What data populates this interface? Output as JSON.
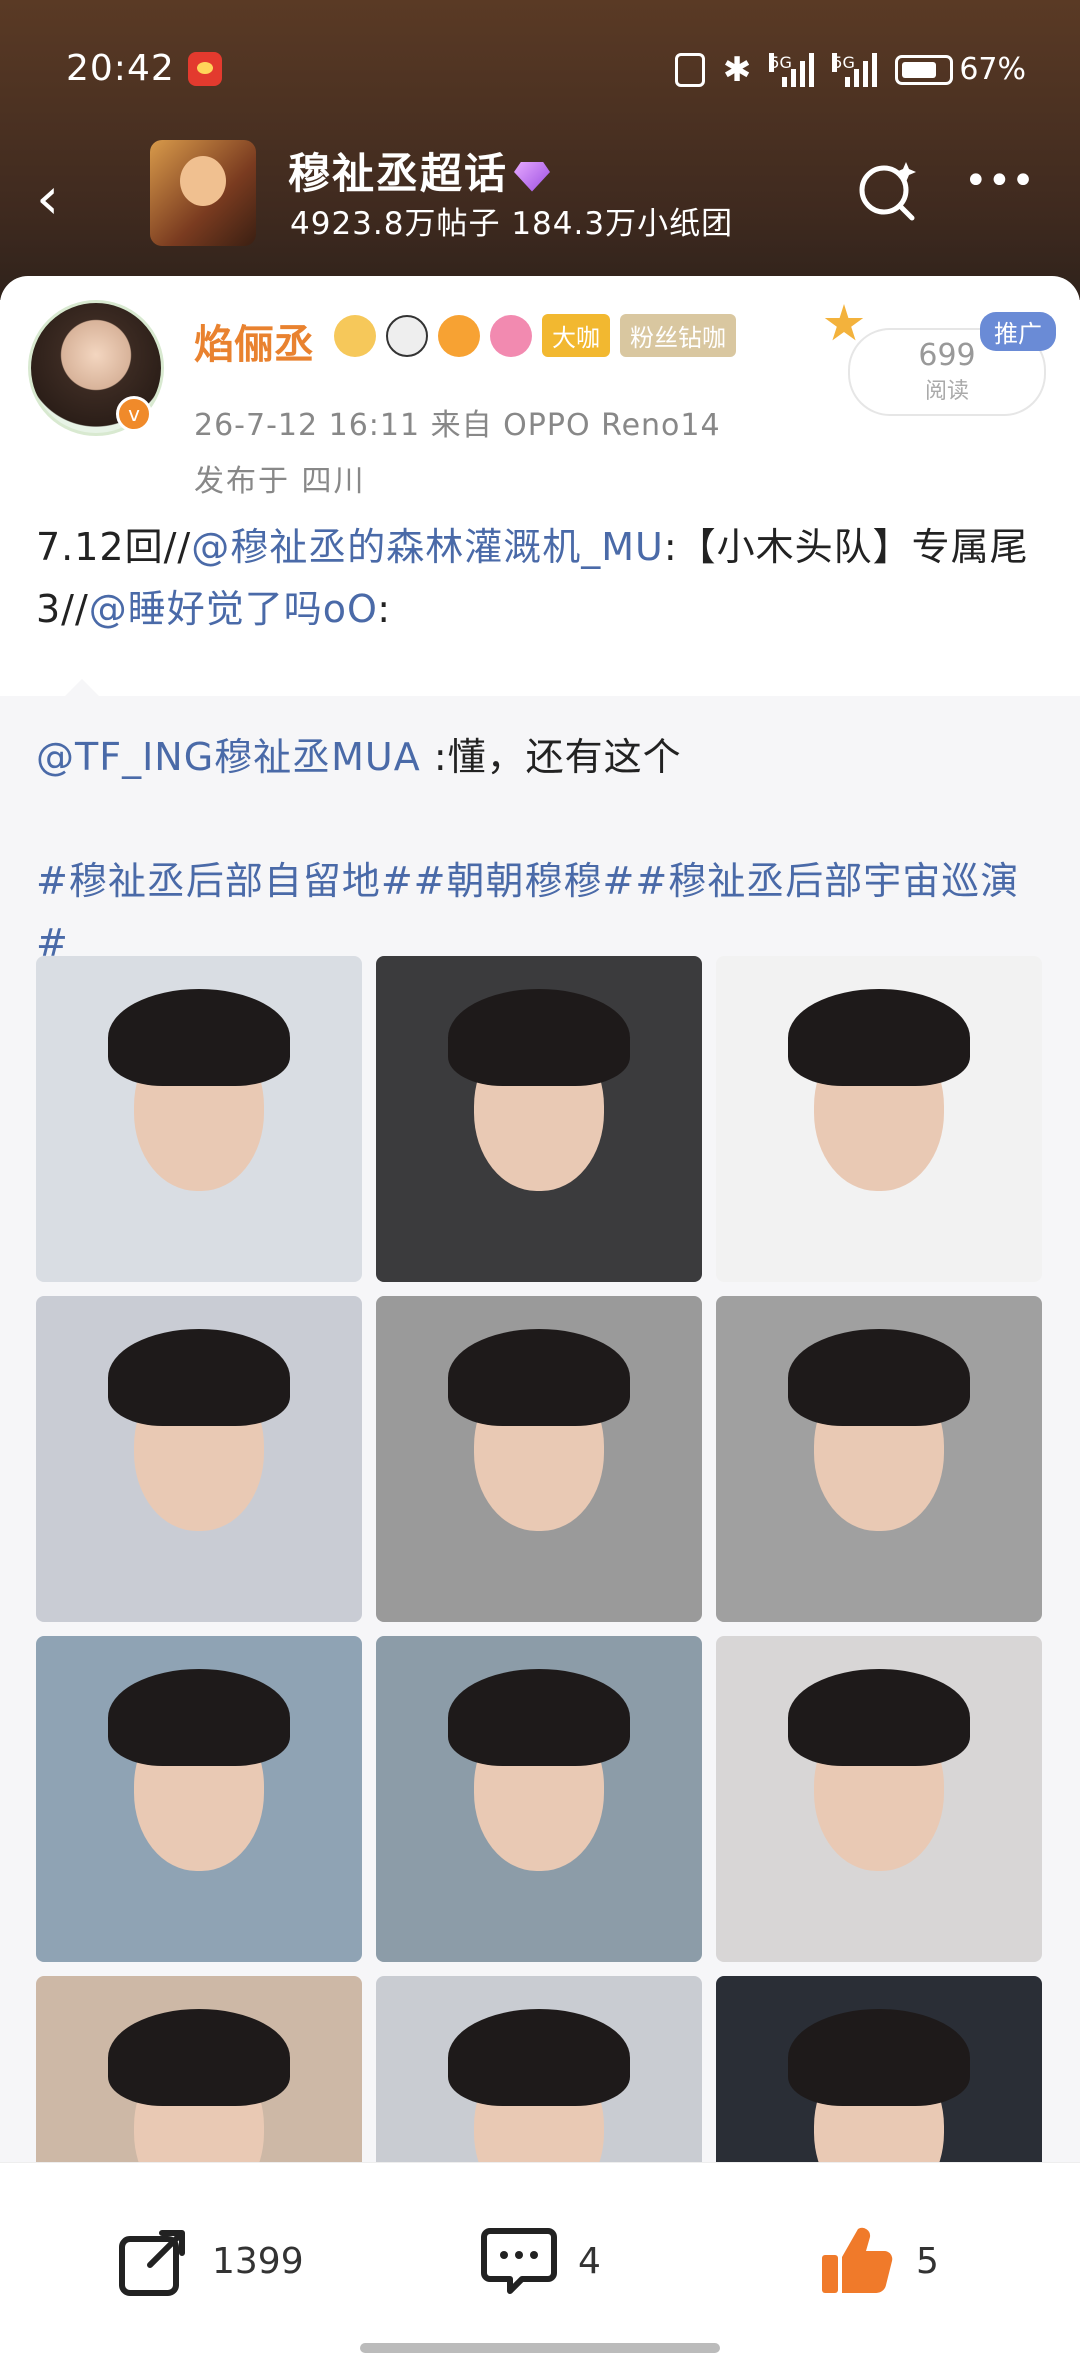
{
  "status_bar": {
    "time": "20:42",
    "net1": "5G",
    "net2": "5G",
    "battery": "67%"
  },
  "topic": {
    "title": "穆祉丞超话",
    "subtitle": "4923.8万帖子 184.3万小纸团"
  },
  "post": {
    "username": "焰俪丞",
    "badge_dakai": "大咖",
    "badge_fans": "粉丝钻咖",
    "time_source": "26-7-12 16:11  来自 OPPO Reno14",
    "location": "发布于 四川",
    "read_count": "699",
    "read_label": "阅读",
    "promo_label": "推广",
    "text_part1": "7.12回//",
    "mention1": "@穆祉丞的森林灌溉机_MU",
    "text_part2": ":【小木头队】专属尾3//",
    "mention2": "@睡好觉了吗oO",
    "text_part3": ":"
  },
  "repost": {
    "mention": "@TF_ING穆祉丞MUA",
    "text": " :懂，还有这个",
    "hashtags": "#穆祉丞后部自留地##朝朝穆穆##穆祉丞后部宇宙巡演#"
  },
  "photos": [
    {
      "bg": "#d9dde3"
    },
    {
      "bg": "#3b3b3d"
    },
    {
      "bg": "#f2f2f2"
    },
    {
      "bg": "#c9ccd4"
    },
    {
      "bg": "#9a9a9a"
    },
    {
      "bg": "#a0a0a0"
    },
    {
      "bg": "#8fa3b4"
    },
    {
      "bg": "#8c9ca8"
    },
    {
      "bg": "#d8d6d6"
    },
    {
      "bg": "#cdb8a6"
    },
    {
      "bg": "#c9ccd2"
    },
    {
      "bg": "#2a2e36"
    }
  ],
  "actions": {
    "share_count": "1399",
    "comment_count": "4",
    "like_count": "5"
  }
}
